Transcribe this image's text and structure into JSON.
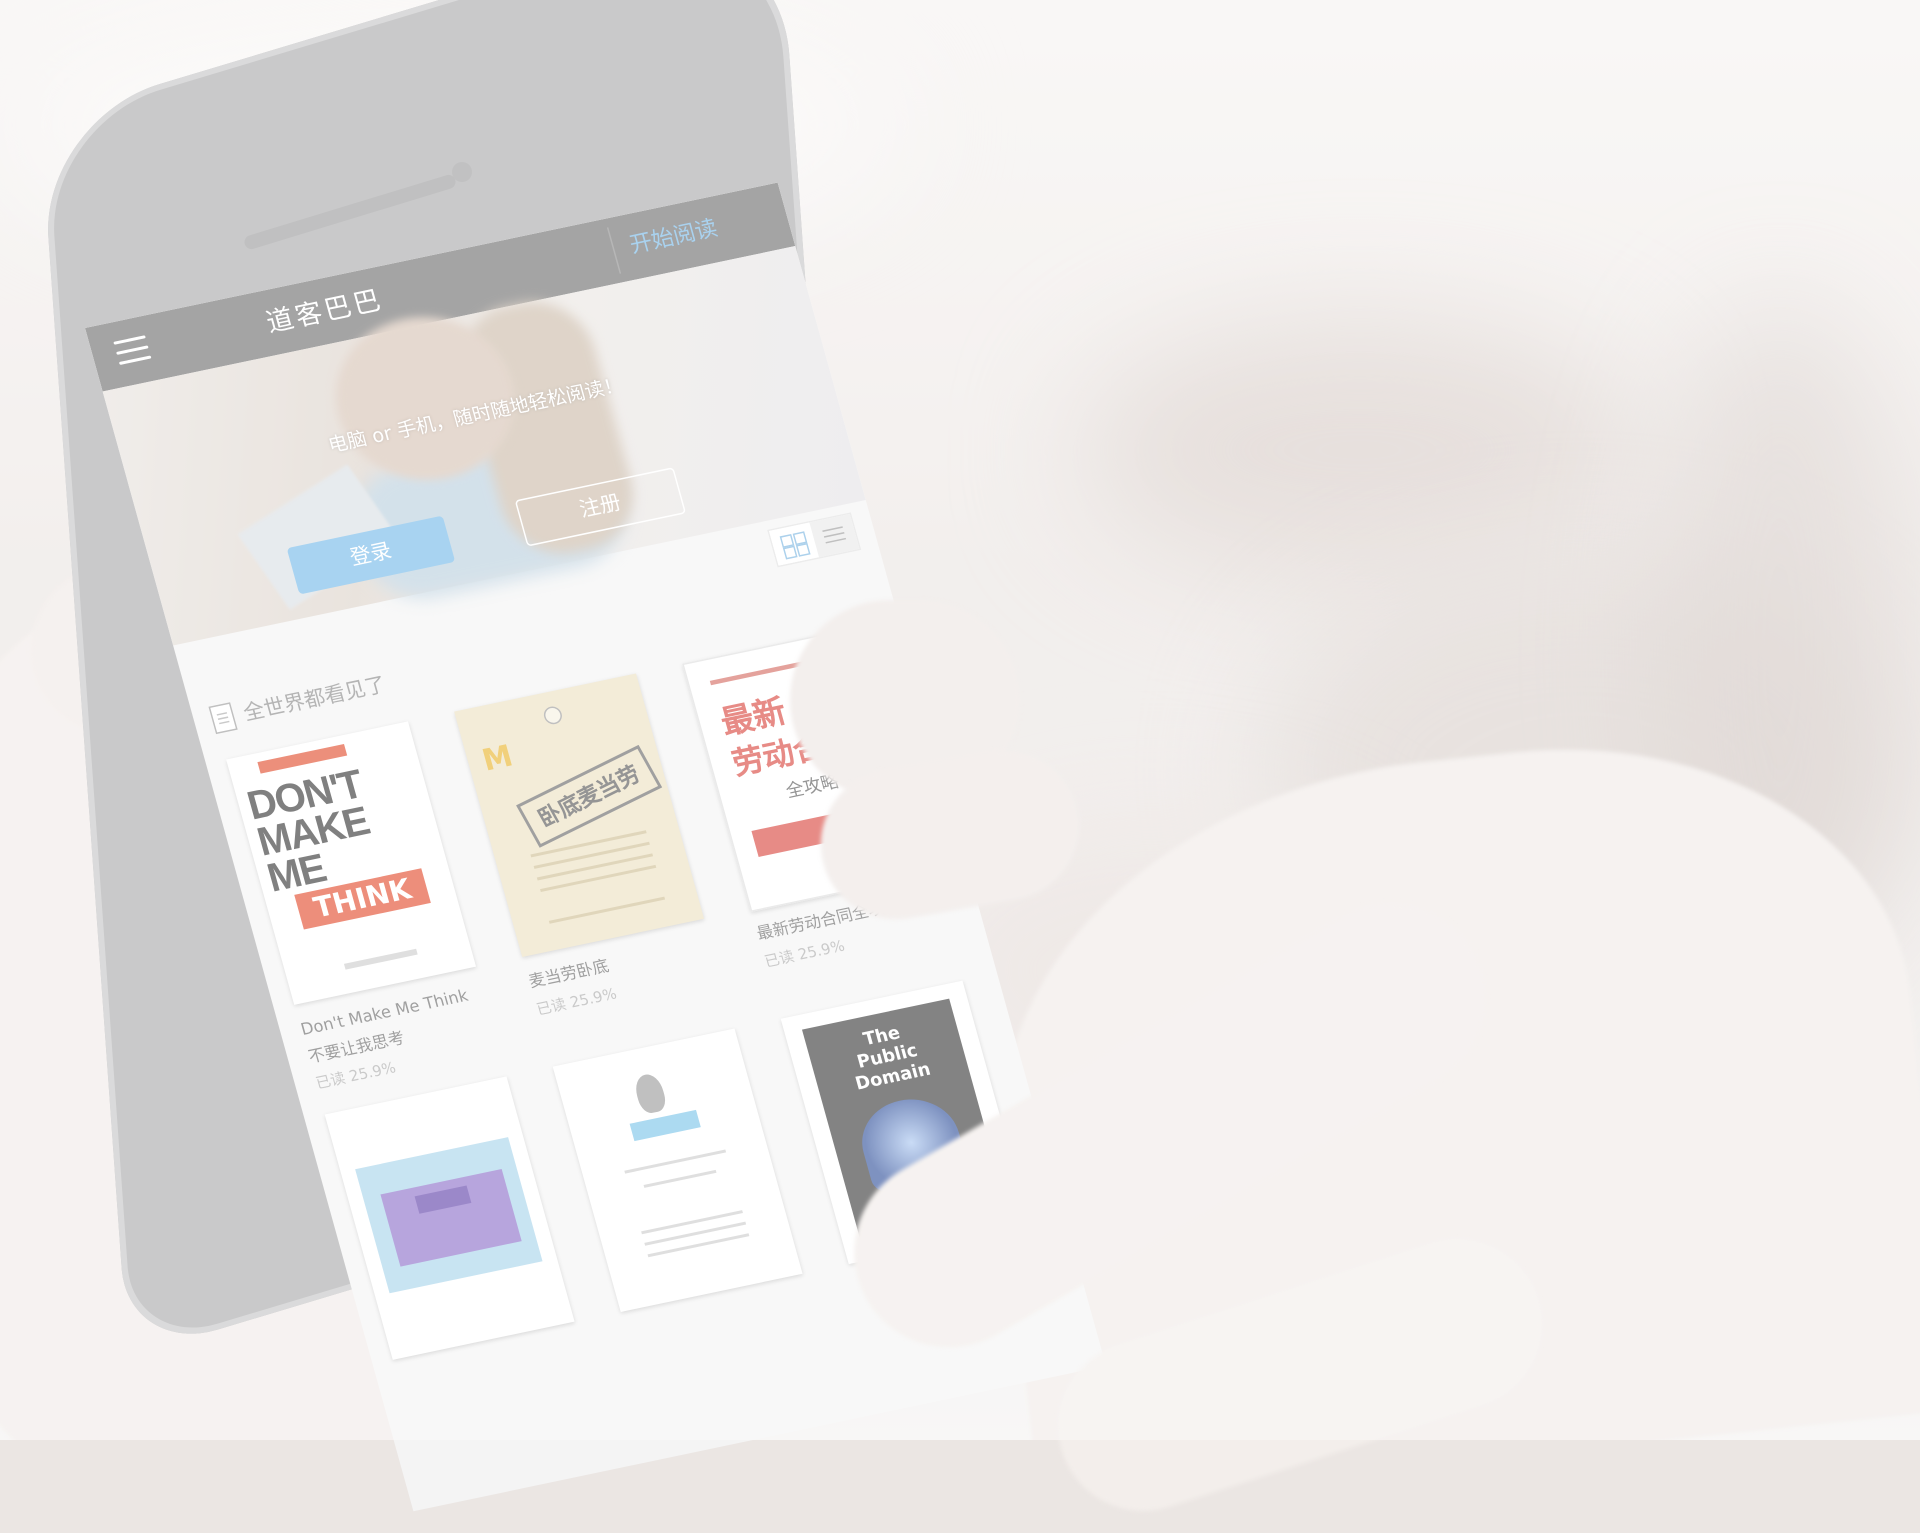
{
  "app": {
    "title": "道客巴巴",
    "start_reading": "开始阅读"
  },
  "hero": {
    "tagline": "电脑 or 手机，随时随地轻松阅读！",
    "login_label": "登录",
    "register_label": "注册"
  },
  "section": {
    "title": "全世界都看见了"
  },
  "books": [
    {
      "title": "Don't Make Me Think",
      "subtitle": "不要让我思考",
      "progress": "已读 25.9%",
      "cover_text": "DON'T\nMAKE\nME",
      "cover_highlight": "THINK"
    },
    {
      "title": "麦当劳卧底",
      "progress": "已读 25.9%",
      "cover_text": "卧底麦当劳",
      "cover_mark": "M"
    },
    {
      "title": "最新劳动合同全攻略",
      "progress": "已读 25.9%",
      "cover_line1": "最新",
      "cover_line2": "劳动合同",
      "cover_line3": "全攻略"
    },
    {
      "cover_desc": "purple slide cover"
    },
    {
      "cover_desc": "ostrich logo cover"
    },
    {
      "cover_title": "The\nPublic\nDomain"
    }
  ],
  "colors": {
    "topbar": "#6d6d6d",
    "accent_blue": "#73b9e8",
    "title_red": "#d8453d"
  }
}
